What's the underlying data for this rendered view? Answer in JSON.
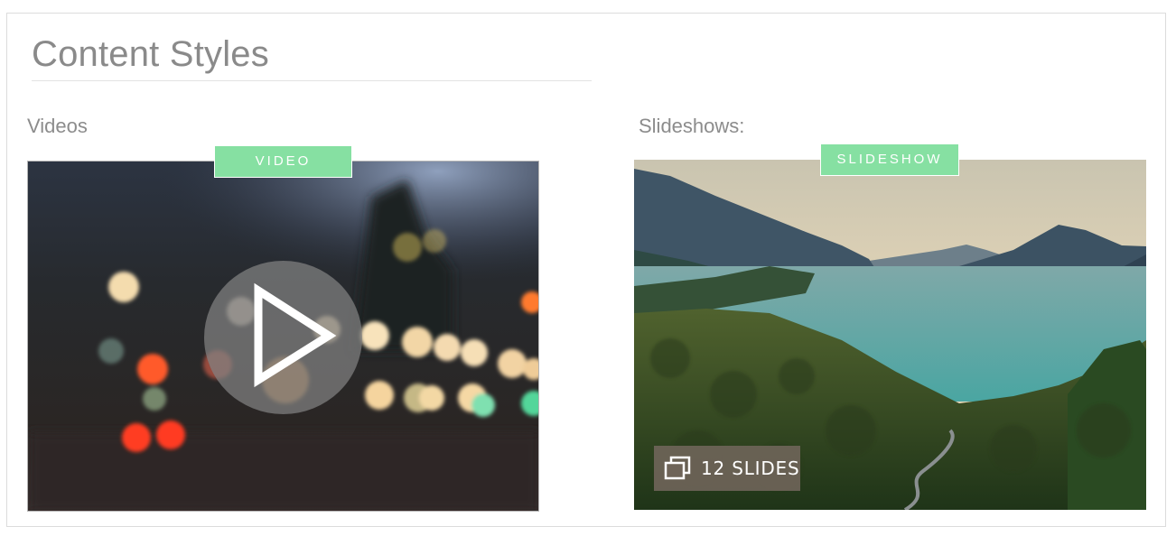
{
  "page": {
    "title": "Content Styles"
  },
  "video_section": {
    "label": "Videos",
    "tag": "VIDEO",
    "play_icon": "play-icon"
  },
  "slideshow_section": {
    "label": "Slideshows:",
    "tag": "SLIDESHOW",
    "badge_icon": "slides-stack-icon",
    "badge_text": "12 SLIDES"
  },
  "colors": {
    "tag_green": "#86e0a2",
    "text_gray": "#8a8a8a",
    "badge_bg": "#6e6458"
  }
}
